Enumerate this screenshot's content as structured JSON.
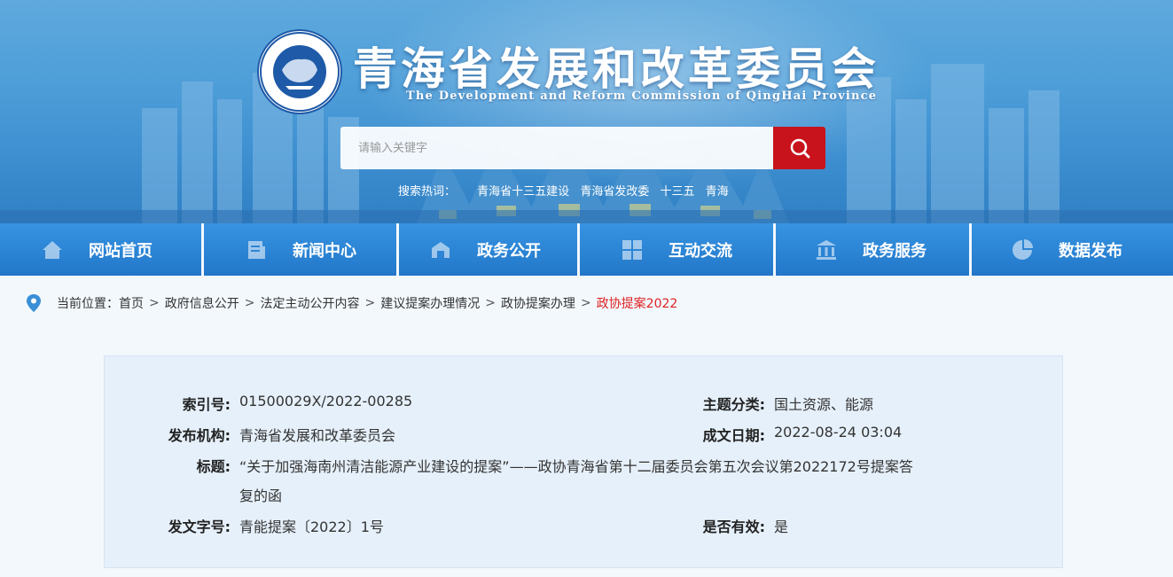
{
  "header": {
    "title": "青海省发展和改革委员会",
    "subtitle": "The Development and Reform Commission of QingHai Province",
    "search_placeholder": "请输入关键字",
    "hot_label": "搜索热词：",
    "hot_words": [
      "青海省十三五建设",
      "青海省发改委",
      "十三五",
      "青海"
    ]
  },
  "nav": {
    "items": [
      {
        "label": "网站首页",
        "icon": "home-icon"
      },
      {
        "label": "新闻中心",
        "icon": "news-icon"
      },
      {
        "label": "政务公开",
        "icon": "open-gov-icon"
      },
      {
        "label": "互动交流",
        "icon": "interact-icon"
      },
      {
        "label": "政务服务",
        "icon": "service-icon"
      },
      {
        "label": "数据发布",
        "icon": "data-chart-icon"
      }
    ]
  },
  "breadcrumb": {
    "prefix": "当前位置：",
    "items": [
      "首页",
      "政府信息公开",
      "法定主动公开内容",
      "建议提案办理情况",
      "政协提案办理"
    ],
    "current": "政协提案2022",
    "separator": ">"
  },
  "meta": {
    "index_label": "索引号:",
    "index_value": "01500029X/2022-00285",
    "topic_label": "主题分类:",
    "topic_value": "国土资源、能源",
    "publisher_label": "发布机构:",
    "publisher_value": "青海省发展和改革委员会",
    "date_label": "成文日期:",
    "date_value": "2022-08-24 03:04",
    "title_label": "标题:",
    "title_value_line1": "“关于加强海南州清洁能源产业建设的提案”——政协青海省第十二届委员会第五次会议第2022172号提案答",
    "title_value_line2": "复的函",
    "docno_label": "发文字号:",
    "docno_value": "青能提案〔2022〕1号",
    "valid_label": "是否有效:",
    "valid_value": "是"
  },
  "colors": {
    "nav_blue": "#2f86d4",
    "search_red": "#c8131c",
    "current_crumb": "#dd2222"
  }
}
